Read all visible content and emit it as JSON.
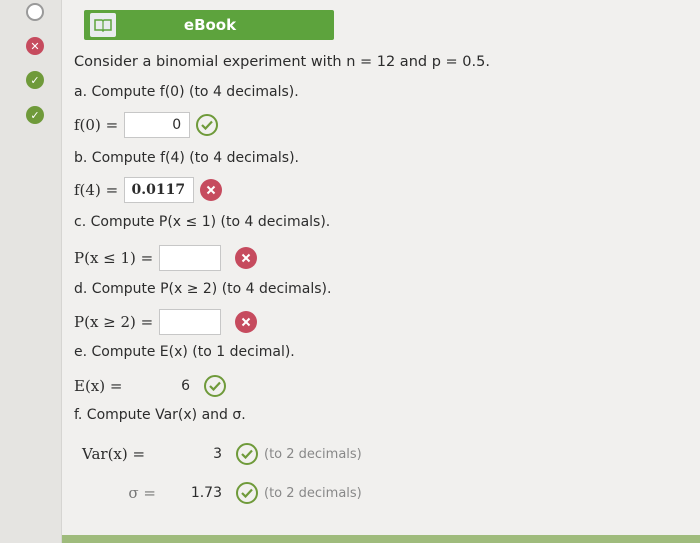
{
  "rail": {
    "statuses": [
      "empty",
      "wrong",
      "right",
      "right"
    ]
  },
  "ebook": {
    "label": "eBook"
  },
  "problem": {
    "intro": "Consider a binomial experiment with n = 12 and p = 0.5.",
    "a": {
      "prompt": "a. Compute f(0) (to 4 decimals).",
      "label": "f(0) =",
      "value": "0",
      "status": "right"
    },
    "b": {
      "prompt": "b. Compute f(4) (to 4 decimals).",
      "label": "f(4) =",
      "value": "0.0117",
      "status": "wrong"
    },
    "c": {
      "prompt": "c. Compute P(x ≤ 1) (to 4 decimals).",
      "label": "P(x ≤ 1) =",
      "value": "",
      "status": "wrong"
    },
    "d": {
      "prompt": "d. Compute P(x ≥ 2) (to 4 decimals).",
      "label": "P(x ≥ 2) =",
      "value": "",
      "status": "wrong"
    },
    "e": {
      "prompt": "e. Compute E(x) (to 1 decimal).",
      "label": "E(x) =",
      "value": "6",
      "status": "right"
    },
    "f": {
      "prompt": "f. Compute Var(x) and σ.",
      "var": {
        "label": "Var(x) =",
        "value": "3",
        "status": "right",
        "hint": "(to 2 decimals)"
      },
      "sigma": {
        "label": "σ =",
        "value": "1.73",
        "status": "right",
        "hint": "(to 2 decimals)"
      }
    }
  },
  "colors": {
    "accent": "#5da33d",
    "wrong": "#c64b5e",
    "right": "#6f9a3a"
  }
}
